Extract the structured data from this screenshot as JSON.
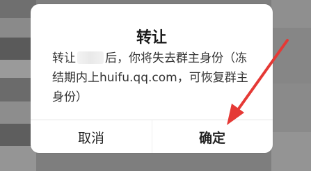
{
  "dialog": {
    "title": "转让",
    "message_prefix": "转让",
    "message_suffix": "后，你将失去群主身份（冻结期内上huifu.qq.com，可恢复群主身份）",
    "cancel_label": "取消",
    "confirm_label": "确定"
  },
  "colors": {
    "annotation_arrow": "#e53935"
  }
}
